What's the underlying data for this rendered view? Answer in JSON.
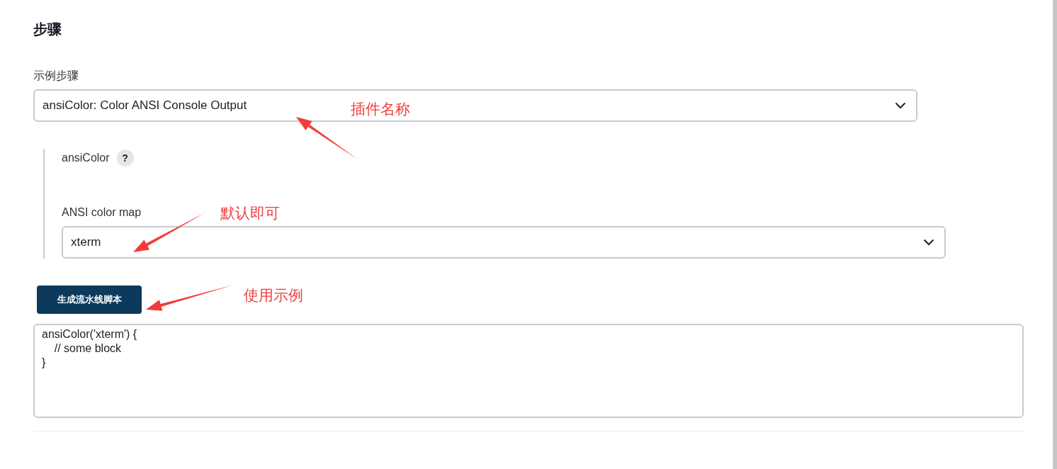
{
  "section": {
    "title": "步骤"
  },
  "sample_step": {
    "label": "示例步骤",
    "value": "ansiColor: Color ANSI Console Output"
  },
  "step_config": {
    "name": "ansiColor",
    "help": "?",
    "color_map": {
      "label": "ANSI color map",
      "value": "xterm"
    }
  },
  "generate_button": "生成流水线脚本",
  "script": "ansiColor('xterm') {\n    // some block\n}",
  "annotations": [
    {
      "text": "插件名称"
    },
    {
      "text": "默认即可"
    },
    {
      "text": "使用示例"
    }
  ]
}
